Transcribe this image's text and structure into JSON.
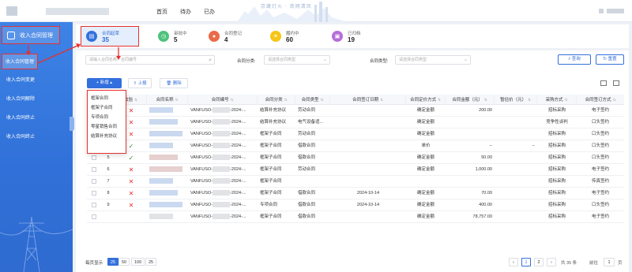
{
  "topnav": [
    "首页",
    "待办",
    "已办"
  ],
  "banner_text": "京畿灯火 · 南网清风",
  "sidebar": {
    "header": "收入合同管理",
    "items": [
      {
        "label": "收入合同管理",
        "active": true
      },
      {
        "label": "收入合同变更",
        "active": false
      },
      {
        "label": "收入合同解除",
        "active": false
      },
      {
        "label": "收入合同终止",
        "active": false
      },
      {
        "label": "收入合同终止",
        "active": false
      }
    ]
  },
  "stats": [
    {
      "label": "合同起草",
      "value": "35",
      "color": "#3470dd",
      "icon": "document-icon"
    },
    {
      "label": "审批中",
      "value": "5",
      "color": "#4fc27e",
      "icon": "clock-icon"
    },
    {
      "label": "合同登记",
      "value": "4",
      "color": "#ea6b47",
      "icon": "user-icon"
    },
    {
      "label": "履约中",
      "value": "60",
      "color": "#f5c518",
      "icon": "sun-icon"
    },
    {
      "label": "已归档",
      "value": "19",
      "color": "#b66ed8",
      "icon": "archive-icon"
    }
  ],
  "filters": {
    "search_placeholder": "请输入合同名称、合同编号",
    "category_label": "合同分类:",
    "category_placeholder": "请选择合同类型",
    "type_label": "合同类型:",
    "type_placeholder": "请选择合同类型",
    "query": "查询",
    "reset": "重置"
  },
  "toolbar": {
    "add": "新增",
    "upload": "上报",
    "delete": "删除"
  },
  "dropdown": [
    "框架合同",
    "框架子合同",
    "专项合同",
    "零星销售合同",
    "结算补充协议"
  ],
  "columns": [
    "",
    "",
    "校验",
    "合同名称",
    "合同编号",
    "合同分类",
    "合同类型",
    "合同签订日期",
    "合同定价方式",
    "合同金额（元）",
    "暂估价（元）",
    "采购方式",
    "合同签订方式"
  ],
  "rows": [
    {
      "idx": "",
      "valid": "x",
      "code": "VANFUSO-",
      "code2": "-2024-...",
      "category": "结算补充协议",
      "type": "劳动合同",
      "date": "",
      "pricing": "确定金额",
      "amount": "200.00",
      "est": "",
      "purchase": "招标采购",
      "sign": "电子签约"
    },
    {
      "idx": "",
      "valid": "x",
      "code": "VANFUSO-",
      "code2": "-2024-...",
      "category": "结算补充协议",
      "type": "电气设备适...",
      "date": "",
      "pricing": "确定金额",
      "amount": "",
      "est": "",
      "purchase": "竞争性谈判",
      "sign": "口头签约"
    },
    {
      "idx": "",
      "valid": "x",
      "code": "VANFUSO-",
      "code2": "-2024-...",
      "category": "框架子合同",
      "type": "劳动合同",
      "date": "",
      "pricing": "确定金额",
      "amount": "",
      "est": "",
      "purchase": "招标采购",
      "sign": "口头签约"
    },
    {
      "idx": "",
      "valid": "ok",
      "code": "VANFUSO-",
      "code2": "-2024-...",
      "category": "框架子合同",
      "type": "借款合同",
      "date": "",
      "pricing": "单价",
      "amount": "--",
      "est": "--",
      "purchase": "招标采购",
      "sign": "口头签约"
    },
    {
      "idx": "5",
      "valid": "ok",
      "code": "VANFUSO-",
      "code2": "-2024-...",
      "category": "框架子合同",
      "type": "借款合同",
      "date": "",
      "pricing": "确定金额",
      "amount": "50.00",
      "est": "",
      "purchase": "招标采购",
      "sign": "口头签约"
    },
    {
      "idx": "6",
      "valid": "x",
      "code": "VANFUSO-",
      "code2": "-2024-...",
      "category": "框架子合同",
      "type": "劳动合同",
      "date": "",
      "pricing": "确定金额",
      "amount": "1,000.00",
      "est": "",
      "purchase": "招标采购",
      "sign": "电子签约"
    },
    {
      "idx": "7",
      "valid": "x",
      "code": "VANFUSO-",
      "code2": "-2024-...",
      "category": "框架子合同",
      "type": "",
      "date": "",
      "pricing": "",
      "amount": "",
      "est": "",
      "purchase": "招标采购",
      "sign": "传真签约"
    },
    {
      "idx": "8",
      "valid": "x",
      "code": "VANFUSO-",
      "code2": "-2024-...",
      "category": "框架子合同",
      "type": "借款合同",
      "date": "2024-10-14",
      "pricing": "确定金额",
      "amount": "70.00",
      "est": "",
      "purchase": "招标采购",
      "sign": "电子签约"
    },
    {
      "idx": "9",
      "valid": "x",
      "code": "VANFUSO-",
      "code2": "-2024-...",
      "category": "专项合同",
      "type": "借款合同",
      "date": "2024-10-14",
      "pricing": "确定金额",
      "amount": "400.00",
      "est": "",
      "purchase": "招标采购",
      "sign": "口头签约"
    },
    {
      "idx": "",
      "valid": "",
      "code": "VANFUSO-",
      "code2": "-2024-...",
      "category": "框架子合同",
      "type": "借款合同",
      "date": "",
      "pricing": "确定金额",
      "amount": "78,757.00",
      "est": "",
      "purchase": "招标采购",
      "sign": "电子签约"
    }
  ],
  "footer": {
    "per_page_label": "每页显示",
    "sizes": [
      "25",
      "50",
      "100",
      "25"
    ],
    "prev": "‹",
    "pages": [
      "1",
      "2"
    ],
    "next": "›",
    "total": "共 35 条",
    "goto_label": "前往",
    "goto_value": "1",
    "page_unit": "页"
  }
}
